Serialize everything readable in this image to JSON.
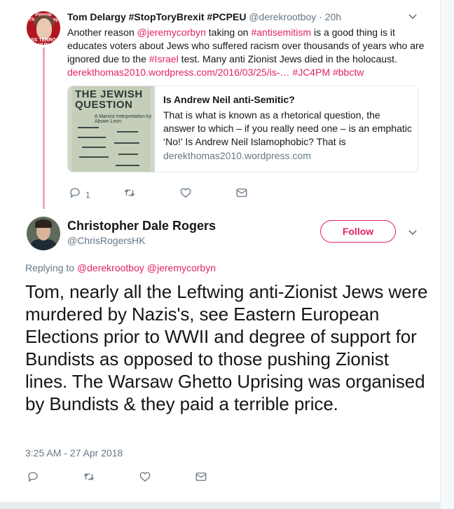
{
  "parent_tweet": {
    "author_name": "Tom Delargy #StopToryBrexit #PCPEU",
    "author_handle": "@derekrootboy",
    "time": "· 20h",
    "avatar_text_top": "Pimpin Theresa May",
    "avatar_text_bottom": "SS TERRO HUN",
    "text": [
      {
        "t": "Another reason ",
        "link": false
      },
      {
        "t": "@jeremycorbyn",
        "link": true
      },
      {
        "t": " taking on ",
        "link": false
      },
      {
        "t": "#antisemitism",
        "link": true
      },
      {
        "t": " is a good thing is it educates voters about Jews who suffered racism over thousands of years who are ignored due to the ",
        "link": false
      },
      {
        "t": "#Israel",
        "link": true
      },
      {
        "t": " test. Many anti Zionist Jews died in the holocaust. ",
        "link": false
      },
      {
        "t": "derekthomas2010.wordpress.com/2016/03/25/is-…",
        "link": true
      },
      {
        "t": " ",
        "link": false
      },
      {
        "t": "#JC4PM",
        "link": true
      },
      {
        "t": " ",
        "link": false
      },
      {
        "t": "#bbctw",
        "link": true
      }
    ],
    "card": {
      "image_title": "THE JEWISH QUESTION",
      "image_subtitle": "A Marxist Interpretation by Abram Leon",
      "title": "Is Andrew Neil anti-Semitic?",
      "description": "  That is what is known as a rhetorical question, the answer to which – if you really need one – is an emphatic ‘No!’ Is Andrew Neil Islamophobic? That is",
      "domain": "derekthomas2010.wordpress.com"
    },
    "reply_count": "1",
    "icons": {
      "reply": "reply-icon",
      "retweet": "retweet-icon",
      "like": "heart-icon",
      "dm": "envelope-icon",
      "more": "chevron-down-icon"
    }
  },
  "main_tweet": {
    "author_name": "Christopher Dale Rogers",
    "author_handle": "@ChrisRogersHK",
    "follow_label": "Follow",
    "replying_prefix": "Replying to ",
    "replying_to": [
      "@derekrootboy",
      "@jeremycorbyn"
    ],
    "text": "Tom, nearly all the Leftwing anti-Zionist Jews were murdered by Nazis's, see Eastern European Elections prior to WWII and degree of support for Bundists as opposed to those pushing Zionist lines. The Warsaw Ghetto Uprising was organised by Bundists & they paid a terrible price.",
    "timestamp": "3:25 AM - 27 Apr 2018"
  },
  "colors": {
    "accent": "#e0245e",
    "muted": "#657786",
    "thread_line": "#f4a4b6",
    "text": "#14171a"
  }
}
